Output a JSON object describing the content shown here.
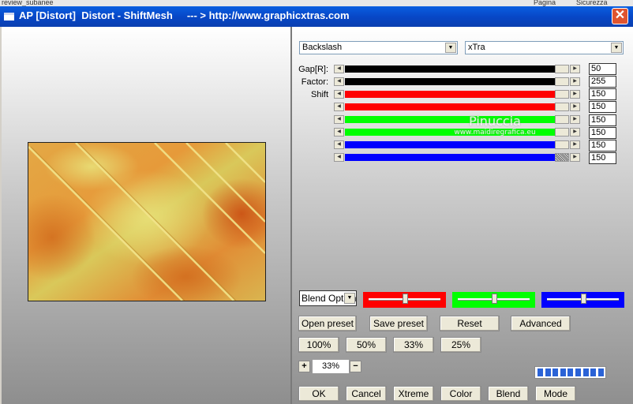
{
  "window": {
    "title": "AP [Distort]  Distort - ShiftMesh     --- > http://www.graphicxtras.com",
    "close_glyph": "✕"
  },
  "background_fragments": [
    "review_subanee",
    "Pagina",
    "Sicurezza"
  ],
  "presets": {
    "effect_select": "Backslash",
    "mode_select": "xTra"
  },
  "params": [
    {
      "label": "Gap[R]:",
      "value": "50",
      "color": "#000000"
    },
    {
      "label": "Factor:",
      "value": "255",
      "color": "#000000"
    },
    {
      "label": "Shift",
      "value": "150",
      "color": "#ff0000"
    },
    {
      "label": "",
      "value": "150",
      "color": "#ff0000"
    },
    {
      "label": "",
      "value": "150",
      "color": "#00ff00"
    },
    {
      "label": "",
      "value": "150",
      "color": "#00ff00"
    },
    {
      "label": "",
      "value": "150",
      "color": "#0000ff"
    },
    {
      "label": "",
      "value": "150",
      "color": "#0000ff"
    }
  ],
  "watermark": {
    "name": "Pinuccia",
    "site": "www.maidiregrafica.eu"
  },
  "blend": {
    "select_label": "Blend Options",
    "sliders": [
      {
        "color": "#ff0000",
        "level": 0.5
      },
      {
        "color": "#00ff00",
        "level": 0.5
      },
      {
        "color": "#0000ff",
        "level": 0.5
      }
    ]
  },
  "buttons": {
    "open_preset": "Open preset",
    "save_preset": "Save preset",
    "reset": "Reset",
    "advanced": "Advanced"
  },
  "zoom_presets": [
    "100%",
    "50%",
    "33%",
    "25%"
  ],
  "zoom": {
    "plus": "+",
    "minus": "−",
    "value": "33%"
  },
  "progress": {
    "segments_filled": 9,
    "segments_total": 9
  },
  "bottom_buttons": {
    "ok": "OK",
    "cancel": "Cancel",
    "xtreme": "Xtreme",
    "color": "Color",
    "blend": "Blend",
    "mode": "Mode"
  }
}
